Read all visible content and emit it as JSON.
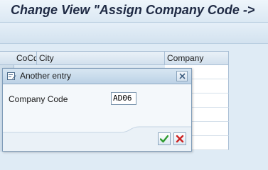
{
  "window": {
    "title": "Change View \"Assign Company Code ->"
  },
  "table": {
    "columns": [
      "CoCd",
      "City",
      "Company"
    ]
  },
  "dialog": {
    "title": "Another entry",
    "field_label": "Company Code",
    "field_value": "AD06",
    "icons": {
      "title_icon": "new-entry-icon",
      "close": "close-icon",
      "ok": "checkmark-icon",
      "cancel": "cancel-icon"
    }
  },
  "colors": {
    "ok_green": "#2e9a2e",
    "cancel_red": "#cc2222"
  }
}
